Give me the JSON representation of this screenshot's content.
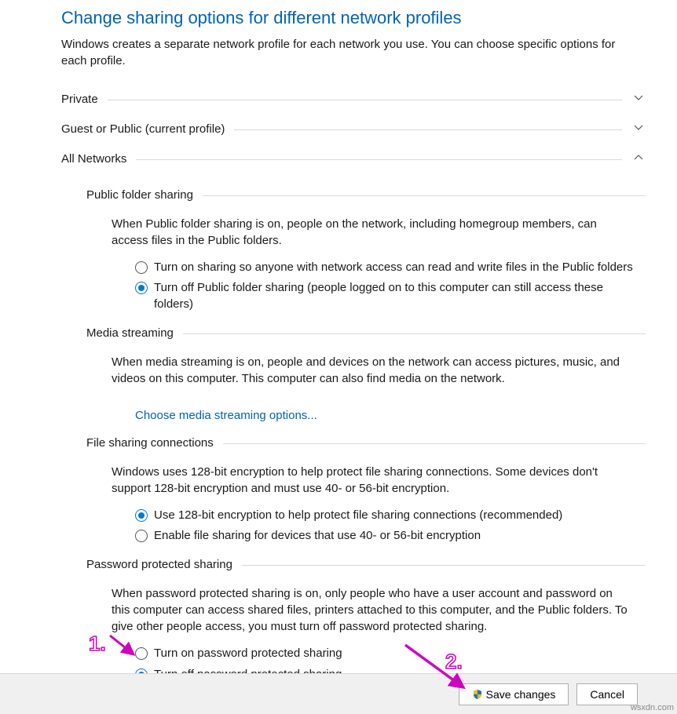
{
  "page": {
    "title": "Change sharing options for different network profiles",
    "description": "Windows creates a separate network profile for each network you use. You can choose specific options for each profile."
  },
  "sections": {
    "private": {
      "label": "Private"
    },
    "guest": {
      "label": "Guest or Public (current profile)"
    },
    "all": {
      "label": "All Networks"
    }
  },
  "public_folder": {
    "title": "Public folder sharing",
    "desc": "When Public folder sharing is on, people on the network, including homegroup members, can access files in the Public folders.",
    "opt1": "Turn on sharing so anyone with network access can read and write files in the Public folders",
    "opt2": "Turn off Public folder sharing (people logged on to this computer can still access these folders)"
  },
  "media": {
    "title": "Media streaming",
    "desc": "When media streaming is on, people and devices on the network can access pictures, music, and videos on this computer. This computer can also find media on the network.",
    "link": "Choose media streaming options..."
  },
  "file_sharing": {
    "title": "File sharing connections",
    "desc": "Windows uses 128-bit encryption to help protect file sharing connections. Some devices don't support 128-bit encryption and must use 40- or 56-bit encryption.",
    "opt1": "Use 128-bit encryption to help protect file sharing connections (recommended)",
    "opt2": "Enable file sharing for devices that use 40- or 56-bit encryption"
  },
  "password": {
    "title": "Password protected sharing",
    "desc": "When password protected sharing is on, only people who have a user account and password on this computer can access shared files, printers attached to this computer, and the Public folders. To give other people access, you must turn off password protected sharing.",
    "opt1": "Turn on password protected sharing",
    "opt2": "Turn off password protected sharing"
  },
  "buttons": {
    "save": "Save changes",
    "cancel": "Cancel"
  },
  "annotations": {
    "one": "1.",
    "two": "2."
  },
  "watermark": "wsxdn.com"
}
